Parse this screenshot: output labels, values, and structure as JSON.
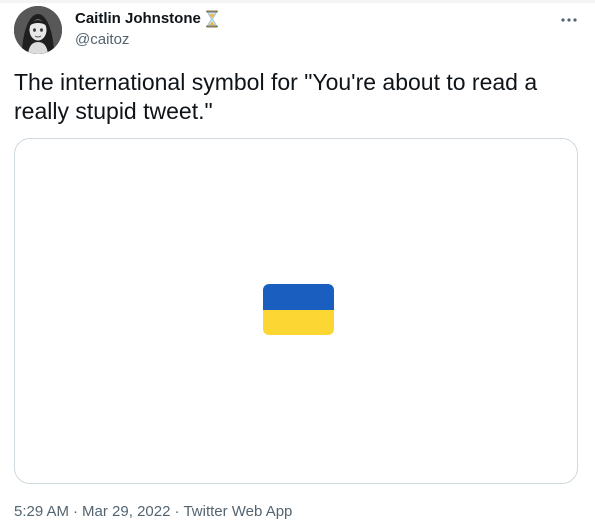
{
  "author": {
    "display_name": "Caitlin Johnstone",
    "handle": "@caitoz",
    "badge_icon": "hourglass-icon"
  },
  "tweet": {
    "text": "The international symbol for \"You're about to read a really stupid tweet.\""
  },
  "media": {
    "image_semantic": "ukraine-flag-emoji",
    "colors": {
      "blue": "#1a5fbf",
      "yellow": "#fcd733"
    }
  },
  "meta": {
    "time": "5:29 AM",
    "separator": "·",
    "date": "Mar 29, 2022",
    "source": "Twitter Web App"
  },
  "colors": {
    "text_primary": "#0f1419",
    "text_secondary": "#536471",
    "border": "#cfd9de"
  }
}
